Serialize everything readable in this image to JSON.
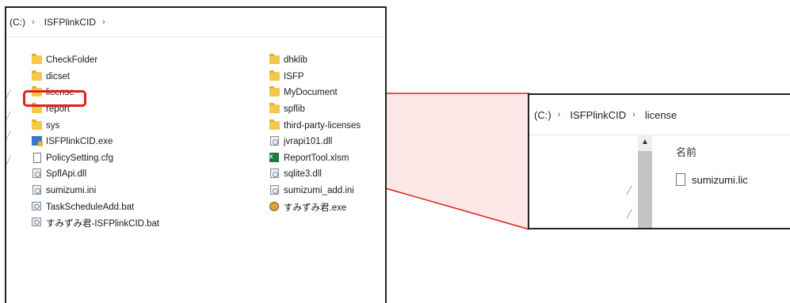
{
  "left_window": {
    "breadcrumb": [
      "(C:)",
      "ISFPlinkCID"
    ],
    "column1": [
      {
        "label": "CheckFolder",
        "icon": "folder-icon"
      },
      {
        "label": "dicset",
        "icon": "folder-icon"
      },
      {
        "label": "license",
        "icon": "folder-icon"
      },
      {
        "label": "report",
        "icon": "folder-icon"
      },
      {
        "label": "sys",
        "icon": "folder-icon"
      },
      {
        "label": "ISFPlinkCID.exe",
        "icon": "exe-icon"
      },
      {
        "label": "PolicySetting.cfg",
        "icon": "file-icon"
      },
      {
        "label": "SpflApi.dll",
        "icon": "dll-icon"
      },
      {
        "label": "sumizumi.ini",
        "icon": "ini-icon"
      },
      {
        "label": "TaskScheduleAdd.bat",
        "icon": "bat-icon"
      },
      {
        "label": "すみずみ君-ISFPlinkCID.bat",
        "icon": "bat-icon"
      }
    ],
    "column2": [
      {
        "label": "dhklib",
        "icon": "folder-icon"
      },
      {
        "label": "ISFP",
        "icon": "folder-icon"
      },
      {
        "label": "MyDocument",
        "icon": "folder-icon"
      },
      {
        "label": "spflib",
        "icon": "folder-icon"
      },
      {
        "label": "third-party-licenses",
        "icon": "folder-icon"
      },
      {
        "label": "jvrapi101.dll",
        "icon": "dll-icon"
      },
      {
        "label": "ReportTool.xlsm",
        "icon": "excel-icon"
      },
      {
        "label": "sqlite3.dll",
        "icon": "dll-icon"
      },
      {
        "label": "sumizumi_add.ini",
        "icon": "ini-icon"
      },
      {
        "label": "すみずみ君.exe",
        "icon": "app-icon"
      }
    ]
  },
  "right_window": {
    "breadcrumb": [
      "(C:)",
      "ISFPlinkCID",
      "license"
    ],
    "column_header": "名前",
    "files": [
      {
        "label": "sumizumi.lic",
        "icon": "file-icon"
      }
    ]
  },
  "colors": {
    "highlight": "#e0201a",
    "folder": "#f6c84a",
    "callout_fill": "#fbe3e3"
  }
}
